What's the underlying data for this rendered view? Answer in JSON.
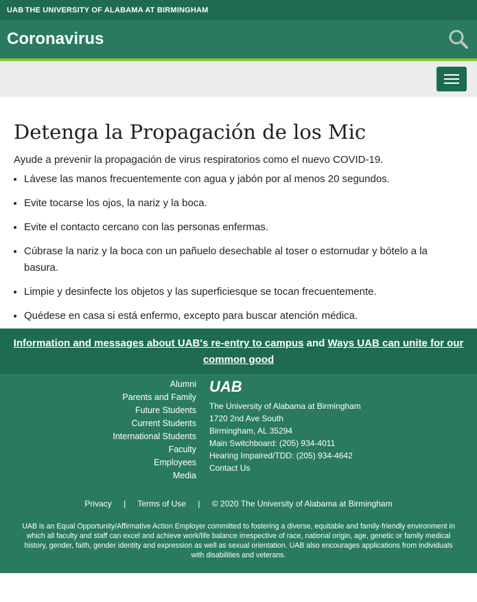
{
  "topbar": {
    "logo": "UAB",
    "text": "THE UNIVERSITY OF ALABAMA AT BIRMINGHAM"
  },
  "header": {
    "title": "Coronavirus",
    "search_icon": "search-icon"
  },
  "nav": {
    "menu_icon": "hamburger-menu-icon"
  },
  "main": {
    "heading": "Detenga la Propagación de los Mic",
    "intro": "Ayude a prevenir la propagación de virus respiratorios como el nuevo COVID-19.",
    "items": [
      "Lávese las manos frecuentemente con agua y jabón por al menos 20 segundos.",
      "Evite tocarse los ojos, la nariz y la boca.",
      "Evite el contacto cercano con las personas enfermas.",
      "Cúbrase la nariz y la boca con un pañuelo desechable al toser o estornudar y bótelo a la basura.",
      "Limpie y desinfecte los objetos y las superficiesque se tocan frecuentemente.",
      "Quédese en casa si está enfermo, excepto para buscar atención médica."
    ]
  },
  "banner": {
    "link1": "Information and messages about UAB's re-entry to campus",
    "and": "and",
    "link2": "Ways UAB can unite for our common good"
  },
  "footer": {
    "links": [
      "Alumni",
      "Parents and Family",
      "Future Students",
      "Current Students",
      "International Students",
      "Faculty",
      "Employees",
      "Media"
    ],
    "logo": "UAB",
    "address": {
      "name": "The University of Alabama at Birmingham",
      "street": "1720 2nd Ave South",
      "city": "Birmingham, AL 35294",
      "switchboard": "Main Switchboard: (205) 934-4011",
      "tdd": "Hearing Impaired/TDD: (205) 934-4642",
      "contact": "Contact Us"
    },
    "legal": {
      "privacy": "Privacy",
      "sep": "|",
      "terms": "Terms of Use",
      "copyright": "© 2020 The University of Alabama at Birmingham"
    },
    "eeo": "UAB is an Equal Opportunity/Affirmative Action Employer committed to fostering a diverse, equitable and family-friendly environment in which all faculty and staff can excel and achieve work/life balance irrespective of race, national origin, age, genetic or family medical history, gender, faith, gender identity and expression as well as sexual orientation. UAB also encourages applications from individuals with disabilities and veterans."
  }
}
